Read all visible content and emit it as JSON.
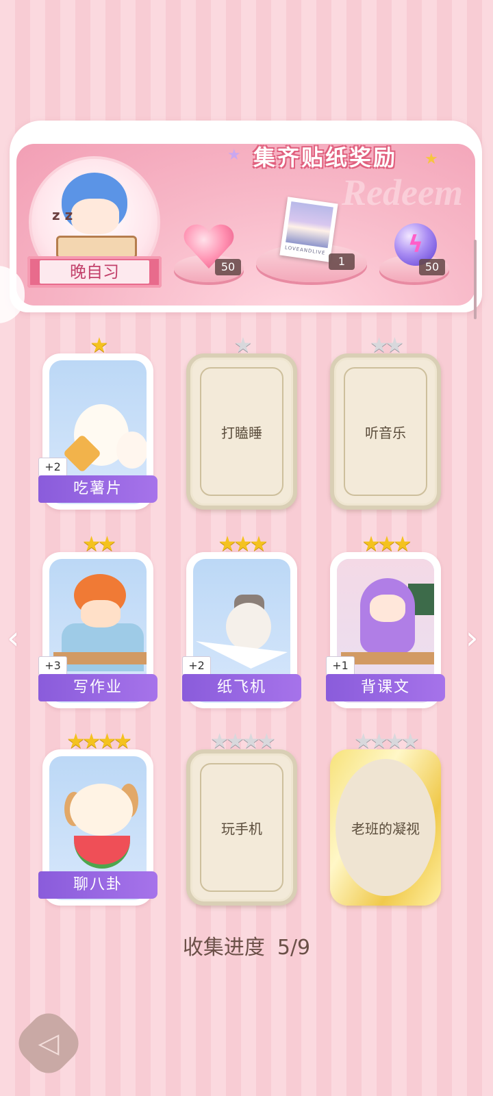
{
  "banner": {
    "title": "集齐贴纸奖励",
    "watermark": "Redeem",
    "avatar_label": "晚自习",
    "rewards": [
      {
        "icon": "pink-heart-gem-icon",
        "count": "50"
      },
      {
        "icon": "photo-card-icon",
        "count": "1",
        "caption": "LOVEANDLIVE"
      },
      {
        "icon": "purple-energy-orb-icon",
        "count": "50"
      }
    ]
  },
  "cards": [
    {
      "label": "吃薯片",
      "stars": 1,
      "max_stars": 1,
      "collected": true,
      "bonus": "+2",
      "art": "white-fox-eating-chips"
    },
    {
      "label": "打瞌睡",
      "stars": 0,
      "max_stars": 1,
      "collected": false
    },
    {
      "label": "听音乐",
      "stars": 0,
      "max_stars": 2,
      "collected": false
    },
    {
      "label": "写作业",
      "stars": 2,
      "max_stars": 2,
      "collected": true,
      "bonus": "+3",
      "art": "boy-doing-homework"
    },
    {
      "label": "纸飞机",
      "stars": 3,
      "max_stars": 3,
      "collected": true,
      "bonus": "+2",
      "art": "cat-on-paper-plane"
    },
    {
      "label": "背课文",
      "stars": 3,
      "max_stars": 3,
      "collected": true,
      "bonus": "+1",
      "art": "girl-in-classroom"
    },
    {
      "label": "聊八卦",
      "stars": 4,
      "max_stars": 4,
      "collected": true,
      "art": "dog-eating-watermelon"
    },
    {
      "label": "玩手机",
      "stars": 0,
      "max_stars": 4,
      "collected": false
    },
    {
      "label": "老班的凝视",
      "stars": 0,
      "max_stars": 4,
      "collected": false,
      "gold": true
    }
  ],
  "progress": {
    "label": "收集进度",
    "value": "5/9"
  },
  "nav": {
    "prev_icon": "chevron-left-icon",
    "next_icon": "chevron-right-icon",
    "back_icon": "back-icon"
  },
  "colors": {
    "tag_purple": "#9a68e4",
    "star_gold": "#f4c21f",
    "background_pink": "#fbd9df"
  }
}
